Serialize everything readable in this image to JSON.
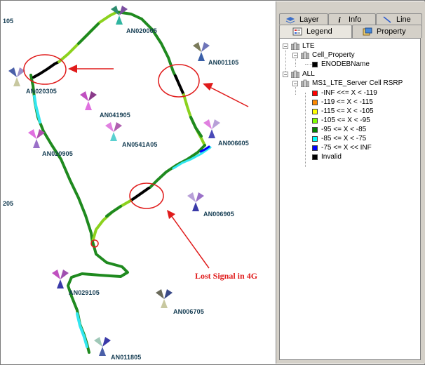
{
  "map": {
    "edge_labels": [
      "105",
      "205"
    ],
    "sites": [
      "AN020005",
      "AN001105",
      "AN020305",
      "AN041905",
      "AN0541A05",
      "AN020905",
      "AN006605",
      "AN006905",
      "AN029105",
      "AN006705",
      "AN011805"
    ],
    "annotation": "Lost Signal in 4G"
  },
  "panel": {
    "tabs": {
      "layer": "Layer",
      "info": "Info",
      "line": "Line",
      "legend": "Legend",
      "property": "Property"
    },
    "tree": {
      "lte": "LTE",
      "cell_property": "Cell_Property",
      "enodeb_name": "ENODEBName",
      "all": "ALL",
      "rsrp_layer": "MS1_LTE_Server Cell RSRP",
      "ranges": [
        {
          "label": "-INF <<= X < -119",
          "color": "#ff0000"
        },
        {
          "label": "-119 <= X < -115",
          "color": "#ff8a00"
        },
        {
          "label": "-115 <= X < -105",
          "color": "#ffff00"
        },
        {
          "label": "-105 <= X < -95",
          "color": "#80ff00"
        },
        {
          "label": "-95 <= X < -85",
          "color": "#008000"
        },
        {
          "label": "-85 <= X < -75",
          "color": "#00ffff"
        },
        {
          "label": "-75 <= X << INF",
          "color": "#0000ff"
        },
        {
          "label": "Invalid",
          "color": "#000000"
        }
      ]
    }
  },
  "colors": {
    "annotation": "#e01b1b",
    "route_green": "#1f8a1f",
    "route_light": "#8cd21e",
    "route_cyan": "#33e6f0",
    "panel_bg": "#d4d0c8"
  }
}
